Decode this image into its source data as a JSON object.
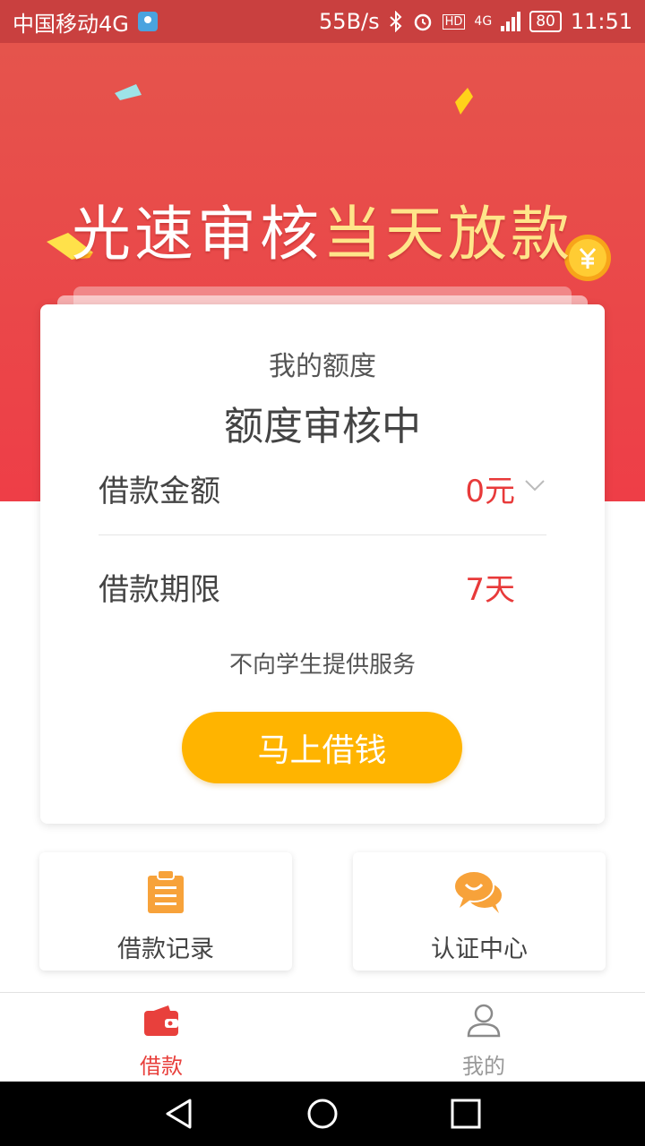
{
  "status_bar": {
    "carrier": "中国移动4G",
    "network_speed": "55B/s",
    "network_type": "4G",
    "hd_label": "HD",
    "battery": "80",
    "time": "11:51"
  },
  "hero": {
    "title_main": "光速审核",
    "title_highlight": "当天放款",
    "colors": {
      "gradient_top": "#e5544c",
      "gradient_bottom": "#ee3e47",
      "highlight": "#ffe58a"
    }
  },
  "card": {
    "label": "我的额度",
    "status": "额度审核中",
    "rows": [
      {
        "label": "借款金额",
        "value": "0元"
      },
      {
        "label": "借款期限",
        "value": "7天"
      }
    ],
    "notice": "不向学生提供服务",
    "cta_label": "马上借钱",
    "colors": {
      "value": "#e83a3a",
      "cta": "#ffb400"
    }
  },
  "quick_actions": [
    {
      "label": "借款记录",
      "icon": "clipboard-icon"
    },
    {
      "label": "认证中心",
      "icon": "chat-bubbles-icon"
    }
  ],
  "tab_bar": {
    "items": [
      {
        "label": "借款",
        "icon": "wallet-icon",
        "active": true,
        "color": "#e8403c"
      },
      {
        "label": "我的",
        "icon": "user-icon",
        "active": false,
        "color": "#999999"
      }
    ]
  },
  "nav_bar": {
    "buttons": [
      "back-icon",
      "home-icon",
      "recents-icon"
    ]
  }
}
